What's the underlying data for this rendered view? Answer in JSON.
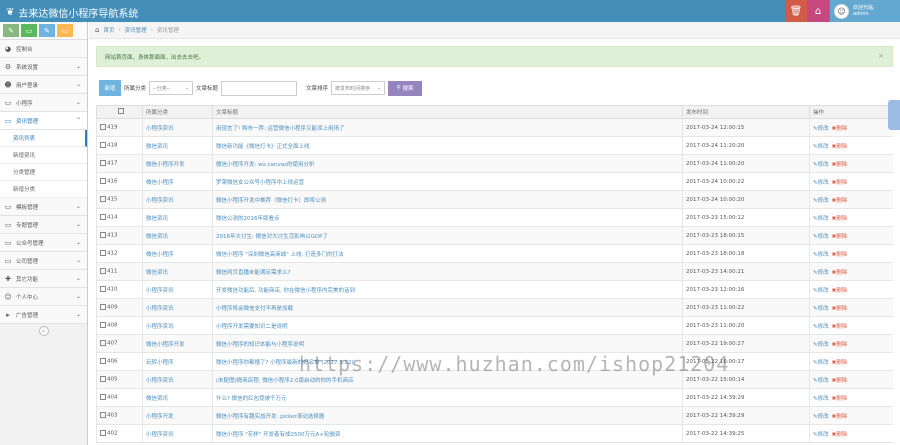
{
  "app": {
    "title": "去来达微信小程序导航系统",
    "welcome": "欢迎光临,",
    "user": "admin"
  },
  "colors": {
    "topbar": "#438eb9",
    "alert_bg": "#dff0d8",
    "link": "#4c8fbd",
    "delete": "#dd5a43",
    "search": "#9585bf"
  },
  "shortcuts": [
    {
      "icon": "pencil-icon",
      "glyph": "✎",
      "color": "#87b87f"
    },
    {
      "icon": "monitor-icon",
      "glyph": "▭",
      "color": "#5cb85c"
    },
    {
      "icon": "pencil-icon",
      "glyph": "✎",
      "color": "#6fb3e0"
    },
    {
      "icon": "monitor-icon",
      "glyph": "▭",
      "color": "#ffb752"
    }
  ],
  "sidebar": {
    "items": [
      {
        "label": "控制台",
        "icon": "dashboard-icon",
        "glyph": "◕"
      },
      {
        "label": "系统设置",
        "icon": "gear-icon",
        "glyph": "⚙"
      },
      {
        "label": "用户登录",
        "icon": "users-icon",
        "glyph": "☻"
      },
      {
        "label": "小程序",
        "icon": "monitor-icon",
        "glyph": "▭"
      },
      {
        "label": "资讯管理",
        "icon": "monitor-icon",
        "glyph": "▭"
      },
      {
        "label": "资讯列表"
      },
      {
        "label": "新增资讯"
      },
      {
        "label": "分类管理"
      },
      {
        "label": "新增分类"
      },
      {
        "label": "模板管理",
        "icon": "monitor-icon",
        "glyph": "▭"
      },
      {
        "label": "专题管理",
        "icon": "monitor-icon",
        "glyph": "▭"
      },
      {
        "label": "公众号管理",
        "icon": "monitor-icon",
        "glyph": "▭"
      },
      {
        "label": "公司管理",
        "icon": "monitor-icon",
        "glyph": "▭"
      },
      {
        "label": "其它功能",
        "icon": "tools-icon",
        "glyph": "✚"
      },
      {
        "label": "个人中心",
        "icon": "user-icon",
        "glyph": "☺"
      },
      {
        "label": "广告管理",
        "icon": "caret-right-icon",
        "glyph": "▸"
      }
    ]
  },
  "breadcrumb": {
    "home": "首页",
    "section": "资讯管理",
    "current": "资讯管理"
  },
  "alert": {
    "text": "网站首页面，身体那面面，出去去去吧。"
  },
  "toolbar": {
    "add": "新增",
    "category_label": "所属分类",
    "category_value": "--分类--",
    "keyword_label": "文章标题",
    "sort_label": "文章排序",
    "sort_value": "按发布时间排序",
    "search": "搜索"
  },
  "table": {
    "headers": [
      "",
      "所属分类",
      "文章标题",
      "发布时间",
      "操作"
    ],
    "edit_label": "修改",
    "delete_label": "删除",
    "rows": [
      {
        "id": "419",
        "category": "小程序资讯",
        "title": "用现言了! 购市一荐: 运营微信小程序又能添上用场了",
        "time": "2017-03-24 12:00:15"
      },
      {
        "id": "418",
        "category": "微信资讯",
        "title": "微信新功能《微信打卡》正式全面上线",
        "time": "2017-03-24 11:20:20"
      },
      {
        "id": "417",
        "category": "微信小程序开发",
        "title": "微信小程序开发: wx.canvas的使用分析",
        "time": "2017-03-24 11:00:20"
      },
      {
        "id": "416",
        "category": "微信小程序",
        "title": "罗莱微信女公众号小程序中上线运营",
        "time": "2017-03-24 10:00:22"
      },
      {
        "id": "415",
        "category": "小程序资讯",
        "title": "微信小程序开发中推荐（微信打卡）即将公测",
        "time": "2017-03-24 10:00:20"
      },
      {
        "id": "414",
        "category": "微信资讯",
        "title": "微信公测的2016年版看点",
        "time": "2017-03-23 15:00:12"
      },
      {
        "id": "413",
        "category": "微信资讯",
        "title": "2016年大讨生: 微信对大讨生活影响以GDP了",
        "time": "2017-03-23 18:00:15"
      },
      {
        "id": "412",
        "category": "微信小程序",
        "title": "微信小程序 \"深圳微信高商城\" 上线, 打造多门的打法",
        "time": "2017-03-23 18:00:18"
      },
      {
        "id": "411",
        "category": "微信资讯",
        "title": "微信网页直播未能满足需求么?",
        "time": "2017-03-23 14:00:21"
      },
      {
        "id": "410",
        "category": "小程序资讯",
        "title": "开发微信功能后, 功能商店, 你在微信小程序内完美的话到",
        "time": "2017-03-23 12:00:16"
      },
      {
        "id": "409",
        "category": "小程序资讯",
        "title": "小程序将会微信支付不再是加载",
        "time": "2017-03-23 11:00:22"
      },
      {
        "id": "408",
        "category": "小程序资讯",
        "title": "小程序开发需要知识二是说明",
        "time": "2017-03-23 11:00:20"
      },
      {
        "id": "407",
        "category": "微信小程序开发",
        "title": "微信小程序的知识本能与小程序说明",
        "time": "2017-03-22 19:00:27"
      },
      {
        "id": "406",
        "category": "玩转小程序",
        "title": "微信小程序你都懂了? 小程序最新的好名单 (2017.3.22)",
        "time": "2017-03-22 16:00:17"
      },
      {
        "id": "405",
        "category": "小程序资讯",
        "title": "(未配图)微商店程, 微信小程序2.0版启动的你的手机商店",
        "time": "2017-03-22 15:00:14"
      },
      {
        "id": "404",
        "category": "微信资讯",
        "title": "什么? 微信的红包竟被千万元",
        "time": "2017-03-22 14:39:29"
      },
      {
        "id": "403",
        "category": "小程序开发",
        "title": "微信小程序有趣实战开发: picker滚动选择器",
        "time": "2017-03-22 14:39:29"
      },
      {
        "id": "402",
        "category": "小程序资讯",
        "title": "微信小程序 \"花样\" 开发者有成2500万元A+轮融资",
        "time": "2017-03-22 14:39:25"
      }
    ]
  },
  "watermark": "https://www.huzhan.com/ishop21204"
}
